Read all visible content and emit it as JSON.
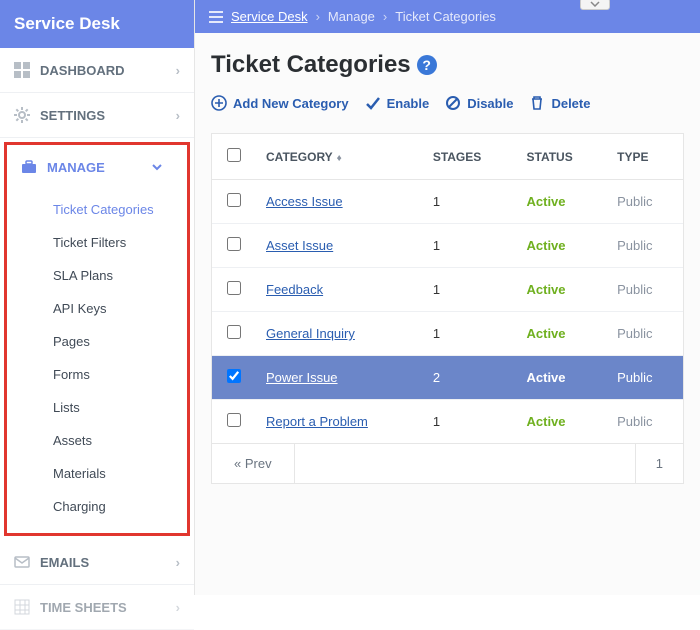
{
  "brand": {
    "title": "Service Desk"
  },
  "breadcrumb": {
    "root": "Service Desk",
    "mid": "Manage",
    "leaf": "Ticket Categories"
  },
  "nav": {
    "dashboard": "DASHBOARD",
    "settings": "SETTINGS",
    "manage": "MANAGE",
    "emails": "EMAILS",
    "timesheets": "TIME SHEETS"
  },
  "subnav": {
    "items": [
      "Ticket Categories",
      "Ticket Filters",
      "SLA Plans",
      "API Keys",
      "Pages",
      "Forms",
      "Lists",
      "Assets",
      "Materials",
      "Charging"
    ]
  },
  "page": {
    "title": "Ticket Categories"
  },
  "toolbar": {
    "add": "Add New Category",
    "enable": "Enable",
    "disable": "Disable",
    "delete": "Delete"
  },
  "columns": {
    "category": "CATEGORY",
    "stages": "STAGES",
    "status": "STATUS",
    "type": "TYPE"
  },
  "rows": [
    {
      "name": "Access Issue",
      "stages": "1",
      "status": "Active",
      "type": "Public",
      "selected": false
    },
    {
      "name": "Asset Issue",
      "stages": "1",
      "status": "Active",
      "type": "Public",
      "selected": false
    },
    {
      "name": "Feedback",
      "stages": "1",
      "status": "Active",
      "type": "Public",
      "selected": false
    },
    {
      "name": "General Inquiry",
      "stages": "1",
      "status": "Active",
      "type": "Public",
      "selected": false
    },
    {
      "name": "Power Issue",
      "stages": "2",
      "status": "Active",
      "type": "Public",
      "selected": true
    },
    {
      "name": "Report a Problem",
      "stages": "1",
      "status": "Active",
      "type": "Public",
      "selected": false
    }
  ],
  "pager": {
    "prev": "« Prev",
    "page": "1"
  }
}
